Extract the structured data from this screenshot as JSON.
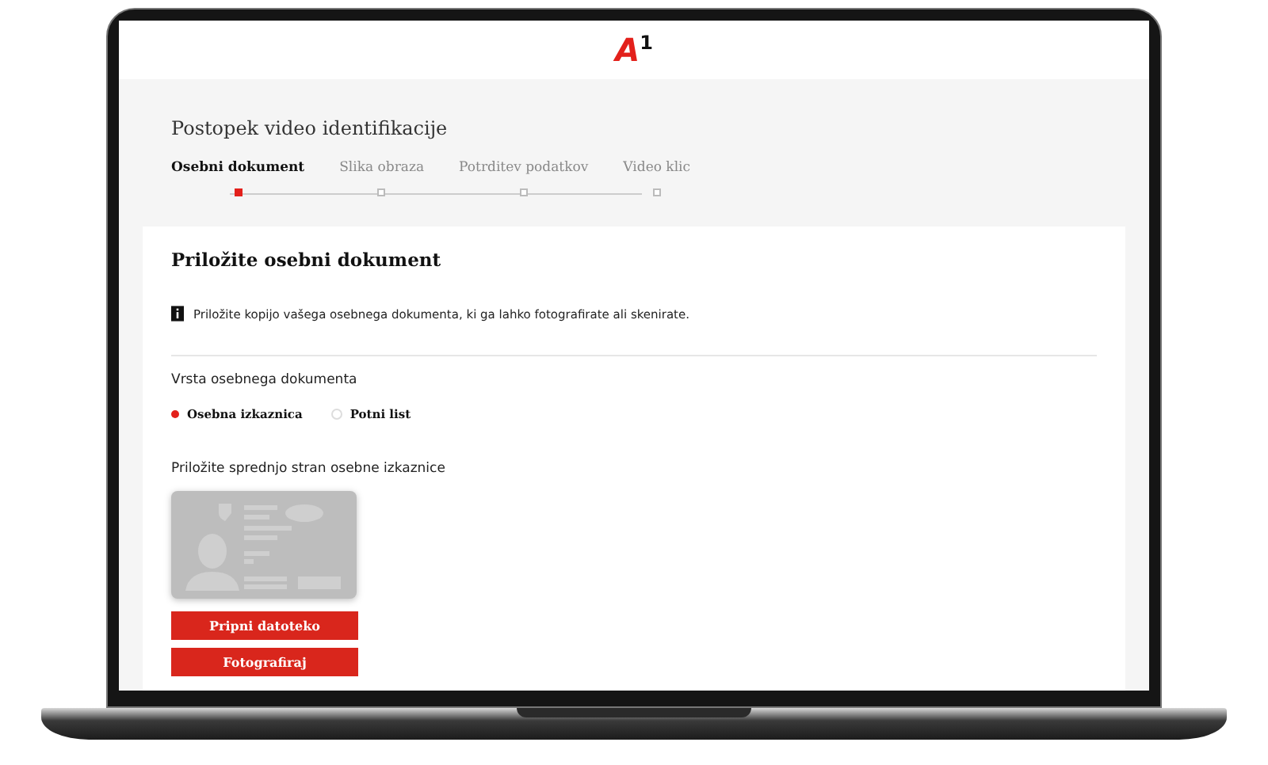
{
  "header": {
    "logo": "A$^{1}$"
  },
  "process": {
    "title": "Postopek video identifikacije",
    "steps": [
      {
        "label": "Osebni dokument",
        "selected": true
      },
      {
        "label": "Slika obraza",
        "selected": false
      },
      {
        "label": "Potrditev podatkov",
        "selected": false
      },
      {
        "label": "Video klic",
        "selected": false
      }
    ]
  },
  "card": {
    "title": "Priložite osebni dokument",
    "info": "Priložite kopijo vašega osebnega dokumenta, ki ga lahko fotografirate ali skenirate.",
    "document_type": {
      "label": "Vrsta osebnega dokumenta",
      "options": [
        {
          "label": "Osebna izkaznica",
          "selected": true
        },
        {
          "label": "Potni list",
          "selected": false
        }
      ]
    },
    "upload": {
      "label": "Priložite sprednjo stran osebne izkaznice",
      "buttons": [
        "Pripni datoteko",
        "Fotografiraj"
      ]
    }
  }
}
